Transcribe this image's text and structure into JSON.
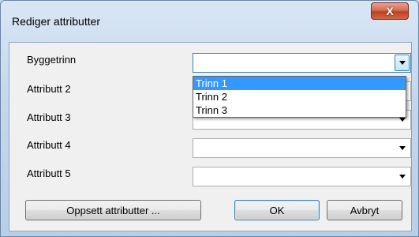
{
  "window": {
    "title": "Rediger attributter",
    "close_glyph": "X"
  },
  "fields": [
    {
      "label": "Byggetrinn",
      "value": ""
    },
    {
      "label": "Attributt 2",
      "value": ""
    },
    {
      "label": "Attributt 3",
      "value": ""
    },
    {
      "label": "Attributt 4",
      "value": ""
    },
    {
      "label": "Attributt 5",
      "value": ""
    }
  ],
  "dropdown": {
    "options": [
      "Trinn 1",
      "Trinn 2",
      "Trinn 3"
    ],
    "selected": "Trinn 1"
  },
  "buttons": {
    "setup": "Oppsett attributter ...",
    "ok": "OK",
    "cancel": "Avbryt"
  },
  "colors": {
    "selection": "#3399ff",
    "close_button": "#c0421f"
  }
}
